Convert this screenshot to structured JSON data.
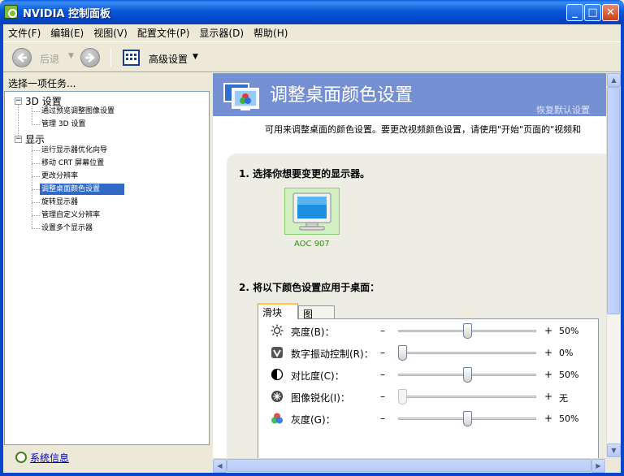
{
  "window": {
    "title": "NVIDIA 控制面板",
    "minimize_glyph": "_",
    "maximize_glyph": "□",
    "close_glyph": "✕"
  },
  "menu": [
    "文件(F)",
    "编辑(E)",
    "视图(V)",
    "配置文件(P)",
    "显示器(D)",
    "帮助(H)"
  ],
  "toolbar": {
    "back_label": "后退",
    "dropdown_glyph": "▼",
    "advanced_label": "高级设置"
  },
  "left_panel": {
    "header": "选择一项任务...",
    "tree": [
      {
        "label": "3D 设置",
        "expander": "−",
        "children": [
          {
            "label": "通过预览调整图像设置",
            "selected": false
          },
          {
            "label": "管理 3D 设置",
            "selected": false
          }
        ]
      },
      {
        "label": "显示",
        "expander": "−",
        "children": [
          {
            "label": "运行显示器优化向导",
            "selected": false
          },
          {
            "label": "移动 CRT 屏幕位置",
            "selected": false
          },
          {
            "label": "更改分辨率",
            "selected": false
          },
          {
            "label": "调整桌面颜色设置",
            "selected": true
          },
          {
            "label": "旋转显示器",
            "selected": false
          },
          {
            "label": "管理自定义分辨率",
            "selected": false
          },
          {
            "label": "设置多个显示器",
            "selected": false
          }
        ]
      }
    ],
    "system_info": "系统信息"
  },
  "main": {
    "title": "调整桌面颜色设置",
    "restore_defaults": "恢复默认设置",
    "description": "可用来调整桌面的颜色设置。要更改视频颜色设置，请使用\"开始\"页面的\"视频和",
    "step1": "1. 选择你想要变更的显示器。",
    "monitor_name": "AOC 907",
    "step2": "2. 将以下颜色设置应用于桌面：",
    "tabs": [
      "滑块",
      "图"
    ],
    "minus_symbol": "–",
    "plus_symbol": "+",
    "sliders": [
      {
        "label": "亮度(B)：",
        "icon": "sun-icon",
        "value_text": "50%",
        "level": 0.5,
        "disabled": false
      },
      {
        "label": "数字振动控制(R)：",
        "icon": "vibrance-icon",
        "value_text": "0%",
        "level": 0.0,
        "disabled": false
      },
      {
        "label": "对比度(C)：",
        "icon": "contrast-icon",
        "value_text": "50%",
        "level": 0.5,
        "disabled": false
      },
      {
        "label": "图像锐化(I)：",
        "icon": "sharpen-icon",
        "value_text": "无",
        "level": 0.0,
        "disabled": true
      },
      {
        "label": "灰度(G)：",
        "icon": "rgb-gamma-icon",
        "value_text": "50%",
        "level": 0.5,
        "disabled": false
      }
    ]
  },
  "colors": {
    "titlebar": "#0a5fe6",
    "banner": "#7490d3",
    "selection": "#316ac5",
    "monitor_highlight": "#d2f0c2",
    "tab_highlight": "#ffc83c"
  }
}
